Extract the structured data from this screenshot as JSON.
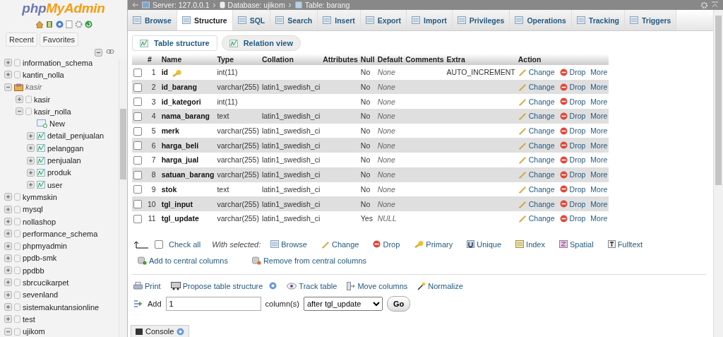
{
  "logo": [
    "php",
    "MyAdmin"
  ],
  "sidebar": {
    "tabs": [
      {
        "label": "Recent"
      },
      {
        "label": "Favorites"
      }
    ],
    "tree": [
      {
        "label": "information_schema",
        "kind": "db",
        "expanded": false
      },
      {
        "label": "kantin_nolla",
        "kind": "db",
        "expanded": false
      },
      {
        "label": "kasir",
        "kind": "group",
        "expanded": true,
        "children": [
          {
            "label": "kasir",
            "kind": "db",
            "expanded": false
          },
          {
            "label": "kasir_nolla",
            "kind": "db",
            "expanded": true,
            "children": [
              {
                "label": "New",
                "kind": "new"
              },
              {
                "label": "detail_penjualan",
                "kind": "table",
                "expanded": false
              },
              {
                "label": "pelanggan",
                "kind": "table",
                "expanded": false
              },
              {
                "label": "penjualan",
                "kind": "table",
                "expanded": false
              },
              {
                "label": "produk",
                "kind": "table",
                "expanded": false
              },
              {
                "label": "user",
                "kind": "table",
                "expanded": false
              }
            ]
          }
        ]
      },
      {
        "label": "kymmskin",
        "kind": "db",
        "expanded": false
      },
      {
        "label": "mysql",
        "kind": "db",
        "expanded": false
      },
      {
        "label": "nollashop",
        "kind": "db",
        "expanded": false
      },
      {
        "label": "performance_schema",
        "kind": "db",
        "expanded": false
      },
      {
        "label": "phpmyadmin",
        "kind": "db",
        "expanded": false
      },
      {
        "label": "ppdb-smk",
        "kind": "db",
        "expanded": false
      },
      {
        "label": "ppdbb",
        "kind": "db",
        "expanded": false
      },
      {
        "label": "sbrcucikarpet",
        "kind": "db",
        "expanded": false
      },
      {
        "label": "sevenland",
        "kind": "db",
        "expanded": false
      },
      {
        "label": "sistemakuntansionline",
        "kind": "db",
        "expanded": false
      },
      {
        "label": "test",
        "kind": "db",
        "expanded": false
      },
      {
        "label": "ujikom",
        "kind": "db",
        "expanded": true
      }
    ]
  },
  "breadcrumb": [
    {
      "label": "Server: 127.0.0.1",
      "kind": "server"
    },
    {
      "label": "Database: ujikom",
      "kind": "database"
    },
    {
      "label": "Table: barang",
      "kind": "table"
    }
  ],
  "tabs": [
    {
      "label": "Browse",
      "selected": false
    },
    {
      "label": "Structure",
      "selected": true
    },
    {
      "label": "SQL",
      "selected": false
    },
    {
      "label": "Search",
      "selected": false
    },
    {
      "label": "Insert",
      "selected": false
    },
    {
      "label": "Export",
      "selected": false
    },
    {
      "label": "Import",
      "selected": false
    },
    {
      "label": "Privileges",
      "selected": false
    },
    {
      "label": "Operations",
      "selected": false
    },
    {
      "label": "Tracking",
      "selected": false
    },
    {
      "label": "Triggers",
      "selected": false
    }
  ],
  "subtabs": [
    {
      "label": "Table structure",
      "selected": true
    },
    {
      "label": "Relation view",
      "selected": false
    }
  ],
  "table": {
    "columns": [
      "#",
      "Name",
      "Type",
      "Collation",
      "Attributes",
      "Null",
      "Default",
      "Comments",
      "Extra",
      "Action"
    ],
    "rows": [
      {
        "num": "1",
        "name": "id",
        "primary": true,
        "type": "int(11)",
        "null": "No",
        "default": "None",
        "extra": "AUTO_INCREMENT",
        "checked": false,
        "actions": [
          "Change",
          "Drop",
          "More"
        ]
      },
      {
        "num": "2",
        "name": "id_barang",
        "primary": false,
        "type": "varchar(255)",
        "collation": "latin1_swedish_ci",
        "null": "No",
        "default": "None",
        "checked": false,
        "actions": [
          "Change",
          "Drop",
          "More"
        ]
      },
      {
        "num": "3",
        "name": "id_kategori",
        "primary": false,
        "type": "int(11)",
        "null": "No",
        "default": "None",
        "checked": false,
        "actions": [
          "Change",
          "Drop",
          "More"
        ]
      },
      {
        "num": "4",
        "name": "nama_barang",
        "primary": false,
        "type": "text",
        "collation": "latin1_swedish_ci",
        "null": "No",
        "default": "None",
        "checked": false,
        "actions": [
          "Change",
          "Drop",
          "More"
        ]
      },
      {
        "num": "5",
        "name": "merk",
        "primary": false,
        "type": "varchar(255)",
        "collation": "latin1_swedish_ci",
        "null": "No",
        "default": "None",
        "checked": false,
        "actions": [
          "Change",
          "Drop",
          "More"
        ]
      },
      {
        "num": "6",
        "name": "harga_beli",
        "primary": false,
        "type": "varchar(255)",
        "collation": "latin1_swedish_ci",
        "null": "No",
        "default": "None",
        "checked": false,
        "actions": [
          "Change",
          "Drop",
          "More"
        ]
      },
      {
        "num": "7",
        "name": "harga_jual",
        "primary": false,
        "type": "varchar(255)",
        "collation": "latin1_swedish_ci",
        "null": "No",
        "default": "None",
        "checked": false,
        "actions": [
          "Change",
          "Drop",
          "More"
        ]
      },
      {
        "num": "8",
        "name": "satuan_barang",
        "primary": false,
        "type": "varchar(255)",
        "collation": "latin1_swedish_ci",
        "null": "No",
        "default": "None",
        "checked": false,
        "actions": [
          "Change",
          "Drop",
          "More"
        ]
      },
      {
        "num": "9",
        "name": "stok",
        "primary": false,
        "type": "text",
        "collation": "latin1_swedish_ci",
        "null": "No",
        "default": "None",
        "checked": false,
        "actions": [
          "Change",
          "Drop",
          "More"
        ]
      },
      {
        "num": "10",
        "name": "tgl_input",
        "primary": false,
        "type": "varchar(255)",
        "collation": "latin1_swedish_ci",
        "null": "No",
        "default": "None",
        "checked": false,
        "actions": [
          "Change",
          "Drop",
          "More"
        ]
      },
      {
        "num": "11",
        "name": "tgl_update",
        "primary": false,
        "type": "varchar(255)",
        "collation": "latin1_swedish_ci",
        "null": "Yes",
        "default": "NULL",
        "checked": false,
        "actions": [
          "Change",
          "Drop",
          "More"
        ]
      }
    ]
  },
  "bulk": {
    "check_all": "Check all",
    "checked": false,
    "with_selected": "With selected:",
    "actions": [
      {
        "label": "Browse",
        "kind": "browse"
      },
      {
        "label": "Change",
        "kind": "change"
      },
      {
        "label": "Drop",
        "kind": "drop"
      },
      {
        "label": "Primary",
        "kind": "primary"
      },
      {
        "label": "Unique",
        "kind": "unique"
      },
      {
        "label": "Index",
        "kind": "index"
      },
      {
        "label": "Spatial",
        "kind": "spatial"
      },
      {
        "label": "Fulltext",
        "kind": "fulltext"
      }
    ],
    "central": [
      {
        "label": "Add to central columns",
        "kind": "add"
      },
      {
        "label": "Remove from central columns",
        "kind": "remove"
      }
    ]
  },
  "tools": [
    {
      "label": "Print",
      "kind": "print"
    },
    {
      "label": "Propose table structure",
      "kind": "propose"
    },
    {
      "label": "Track table",
      "kind": "track"
    },
    {
      "label": "Move columns",
      "kind": "move"
    },
    {
      "label": "Normalize",
      "kind": "normalize"
    }
  ],
  "add_columns": {
    "label": "Add",
    "value": "1",
    "unit": "column(s)",
    "position": "after tgl_update",
    "button": "Go"
  },
  "console": "Console"
}
